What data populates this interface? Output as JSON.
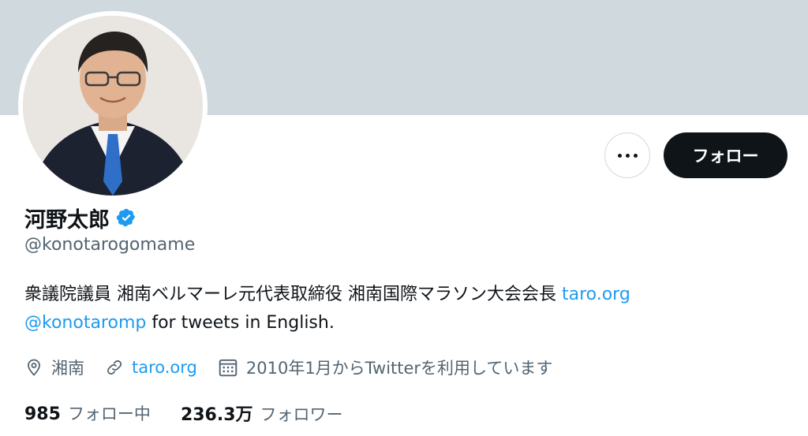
{
  "profile": {
    "display_name": "河野太郎",
    "handle": "@konotarogomame",
    "bio": {
      "text": "衆議院議員 湘南ベルマーレ元代表取締役 湘南国際マラソン大会会長 ",
      "link": "taro.org",
      "mention": "@konotaromp",
      "suffix": " for tweets in English."
    },
    "meta": {
      "location": "湘南",
      "website": "taro.org",
      "joined": "2010年1月からTwitterを利用しています"
    },
    "stats": {
      "following_count": "985",
      "following_label": "フォロー中",
      "followers_count": "236.3万",
      "followers_label": "フォロワー"
    }
  },
  "actions": {
    "more_icon": "more-horizontal-icon",
    "follow_label": "フォロー"
  },
  "icons": {
    "verified": "verified-badge-icon",
    "location": "location-pin-icon",
    "link": "link-icon",
    "calendar": "calendar-icon"
  },
  "colors": {
    "banner": "#cfd9de",
    "link": "#1d9bf0",
    "secondary_text": "#536471",
    "primary_text": "#0f1419",
    "follow_button": "#0f1419"
  }
}
